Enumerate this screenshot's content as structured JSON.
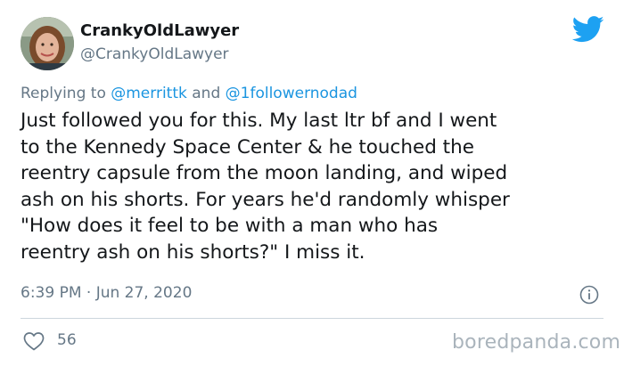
{
  "author": {
    "display_name": "CrankyOldLawyer",
    "handle": "@CrankyOldLawyer"
  },
  "reply": {
    "prefix": "Replying to ",
    "mention_1": "@merrittk",
    "joiner": " and ",
    "mention_2": "@1followernodad"
  },
  "tweet": {
    "lines": [
      "Just followed you for this. My last ltr bf and I went",
      "to the Kennedy Space Center & he touched the",
      "reentry capsule from the moon landing, and wiped",
      "ash on his shorts. For years he'd randomly whisper",
      "\"How does it feel to be with a man who has",
      "reentry ash on his shorts?\" I miss it."
    ],
    "timestamp": "6:39 PM · Jun 27, 2020"
  },
  "engagement": {
    "likes": "56"
  },
  "watermark": "boredpanda.com",
  "icons": {
    "brand": "twitter-bird-icon",
    "info": "info-icon",
    "like": "heart-icon"
  },
  "colors": {
    "link": "#1b95e0",
    "brand": "#1da1f2",
    "secondary_text": "#657786",
    "primary_text": "#14171a",
    "divider": "#ccd6dd"
  }
}
